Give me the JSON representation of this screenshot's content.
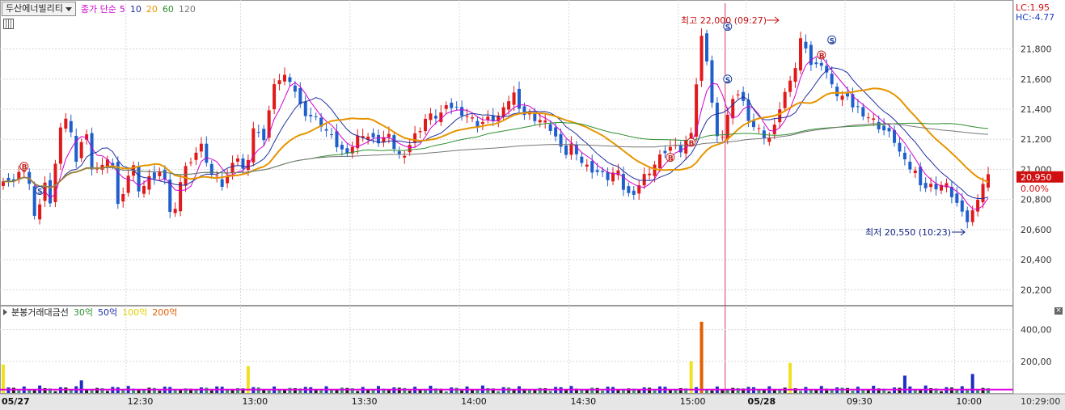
{
  "header": {
    "ticker": "두산에너빌리티",
    "ma_label": "종가 단순",
    "ma_periods": [
      {
        "label": "5",
        "color": "#d000d0"
      },
      {
        "label": "10",
        "color": "#1f2fa0"
      },
      {
        "label": "20",
        "color": "#e69500"
      },
      {
        "label": "60",
        "color": "#2f8f2f"
      },
      {
        "label": "120",
        "color": "#777777"
      }
    ]
  },
  "limits": {
    "lc": "LC:1.95",
    "hc": "HC:-4.77"
  },
  "price_axis": {
    "ticks": [
      "21,800",
      "21,600",
      "21,400",
      "21,200",
      "21,000",
      "20,800",
      "20,600",
      "20,400",
      "20,200"
    ],
    "ticks_values": [
      21800,
      21600,
      21400,
      21200,
      21000,
      20800,
      20600,
      20400,
      20200
    ],
    "current_price": "20,950",
    "current_change": "0.00%"
  },
  "annotations": {
    "high": "최고 22,000 (09:27)",
    "low": "최저 20,550 (10:23)",
    "buy_marker": "B",
    "sell_marker": "S"
  },
  "volume": {
    "title": "분봉거래대금선",
    "levels": [
      {
        "label": "30억",
        "color": "#2f8f2f"
      },
      {
        "label": "50억",
        "color": "#1f2fa0"
      },
      {
        "label": "100억",
        "color": "#e0d000"
      },
      {
        "label": "200억",
        "color": "#e06000"
      }
    ],
    "axis_ticks": [
      "400,00",
      "200,00"
    ],
    "axis_values": [
      400,
      200
    ],
    "close_label": "×"
  },
  "time_axis": {
    "labels": [
      "05/27",
      "12:30",
      "13:00",
      "13:30",
      "14:00",
      "14:30",
      "15:00",
      "05/28",
      "09:30",
      "10:00"
    ],
    "right_label": "10:29:00"
  },
  "colors": {
    "up": "#e01a1a",
    "down": "#1f5fcc",
    "ma5": "#d000d0",
    "ma10": "#1f2fa0",
    "ma20": "#e69500",
    "ma60": "#2f8f2f",
    "ma120": "#777777"
  },
  "chart_data": {
    "type": "candlestick",
    "ylim": [
      20100,
      22050
    ],
    "anchors": [
      [
        0,
        20950
      ],
      [
        8,
        20900
      ],
      [
        14,
        21050
      ],
      [
        20,
        20900
      ],
      [
        26,
        20650
      ],
      [
        32,
        20900
      ],
      [
        38,
        20760
      ],
      [
        44,
        21300
      ],
      [
        50,
        21350
      ],
      [
        58,
        21050
      ],
      [
        64,
        21280
      ],
      [
        70,
        21000
      ],
      [
        78,
        21000
      ],
      [
        84,
        21120
      ],
      [
        90,
        20800
      ],
      [
        96,
        20860
      ],
      [
        102,
        21070
      ],
      [
        108,
        20780
      ],
      [
        114,
        20980
      ],
      [
        120,
        20920
      ],
      [
        126,
        21000
      ],
      [
        132,
        20650
      ],
      [
        140,
        20950
      ],
      [
        148,
        21080
      ],
      [
        156,
        21150
      ],
      [
        164,
        20960
      ],
      [
        174,
        20880
      ],
      [
        182,
        21130
      ],
      [
        190,
        20950
      ],
      [
        196,
        21280
      ],
      [
        204,
        21180
      ],
      [
        212,
        21520
      ],
      [
        218,
        21620
      ],
      [
        226,
        21610
      ],
      [
        234,
        21400
      ],
      [
        242,
        21350
      ],
      [
        250,
        21300
      ],
      [
        258,
        21200
      ],
      [
        266,
        21120
      ],
      [
        274,
        21150
      ],
      [
        282,
        21250
      ],
      [
        292,
        21180
      ],
      [
        302,
        21220
      ],
      [
        312,
        21080
      ],
      [
        322,
        21200
      ],
      [
        332,
        21340
      ],
      [
        342,
        21360
      ],
      [
        352,
        21420
      ],
      [
        362,
        21380
      ],
      [
        372,
        21300
      ],
      [
        382,
        21330
      ],
      [
        392,
        21360
      ],
      [
        400,
        21520
      ],
      [
        410,
        21360
      ],
      [
        420,
        21340
      ],
      [
        432,
        21260
      ],
      [
        440,
        21080
      ],
      [
        448,
        21180
      ],
      [
        456,
        21020
      ],
      [
        464,
        21000
      ],
      [
        474,
        20940
      ],
      [
        482,
        20990
      ],
      [
        490,
        20820
      ],
      [
        498,
        20880
      ],
      [
        506,
        20980
      ],
      [
        514,
        21050
      ],
      [
        522,
        21150
      ],
      [
        532,
        21120
      ],
      [
        540,
        21230
      ],
      [
        550,
        21960
      ],
      [
        556,
        21500
      ],
      [
        562,
        21140
      ],
      [
        570,
        21380
      ],
      [
        578,
        21520
      ],
      [
        588,
        21300
      ],
      [
        596,
        21240
      ],
      [
        604,
        21200
      ],
      [
        612,
        21480
      ],
      [
        620,
        21580
      ],
      [
        628,
        21920
      ],
      [
        636,
        21660
      ],
      [
        644,
        21720
      ],
      [
        652,
        21520
      ],
      [
        660,
        21480
      ],
      [
        668,
        21420
      ],
      [
        676,
        21380
      ],
      [
        684,
        21320
      ],
      [
        692,
        21260
      ],
      [
        700,
        21200
      ],
      [
        708,
        21040
      ],
      [
        716,
        20990
      ],
      [
        724,
        20880
      ],
      [
        732,
        20890
      ],
      [
        740,
        20900
      ],
      [
        748,
        20800
      ],
      [
        756,
        20640
      ],
      [
        762,
        20720
      ],
      [
        768,
        20890
      ],
      [
        774,
        20950
      ]
    ],
    "volume_spikes": [
      [
        0,
        180
      ],
      [
        192,
        170
      ],
      [
        550,
        450
      ],
      [
        540,
        200
      ],
      [
        620,
        190
      ],
      [
        708,
        110
      ],
      [
        760,
        120
      ],
      [
        60,
        80
      ]
    ]
  }
}
